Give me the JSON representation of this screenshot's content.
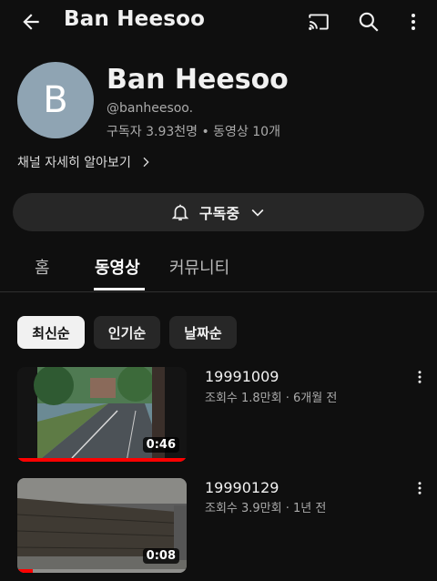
{
  "topbar": {
    "title": "Ban Heesoo",
    "icons": [
      "back-arrow-icon",
      "cast-icon",
      "search-icon",
      "more-vert-icon"
    ]
  },
  "channel": {
    "avatar_letter": "B",
    "avatar_color": "#8fa4b3",
    "name": "Ban Heesoo",
    "handle": "@banheesoo.",
    "stats": "구독자 3.93천명 • 동영상 10개",
    "more_info": "채널 자세히 알아보기"
  },
  "subscribe": {
    "label": "구독중"
  },
  "tabs": [
    {
      "label": "홈",
      "active": false
    },
    {
      "label": "동영상",
      "active": true
    },
    {
      "label": "커뮤니티",
      "active": false
    }
  ],
  "chips": [
    {
      "label": "최신순",
      "active": true
    },
    {
      "label": "인기순",
      "active": false
    },
    {
      "label": "날짜순",
      "active": false
    }
  ],
  "videos": [
    {
      "title": "19991009",
      "meta": "조회수 1.8만회 · 6개월 전",
      "duration": "0:46",
      "watched_fraction": 1.0
    },
    {
      "title": "19990129",
      "meta": "조회수 3.9만회 · 1년 전",
      "duration": "0:08",
      "watched_fraction": 0.09
    }
  ],
  "colors": {
    "background": "#0f0f0f",
    "progress": "#ff0000",
    "chip_bg": "#272727"
  }
}
